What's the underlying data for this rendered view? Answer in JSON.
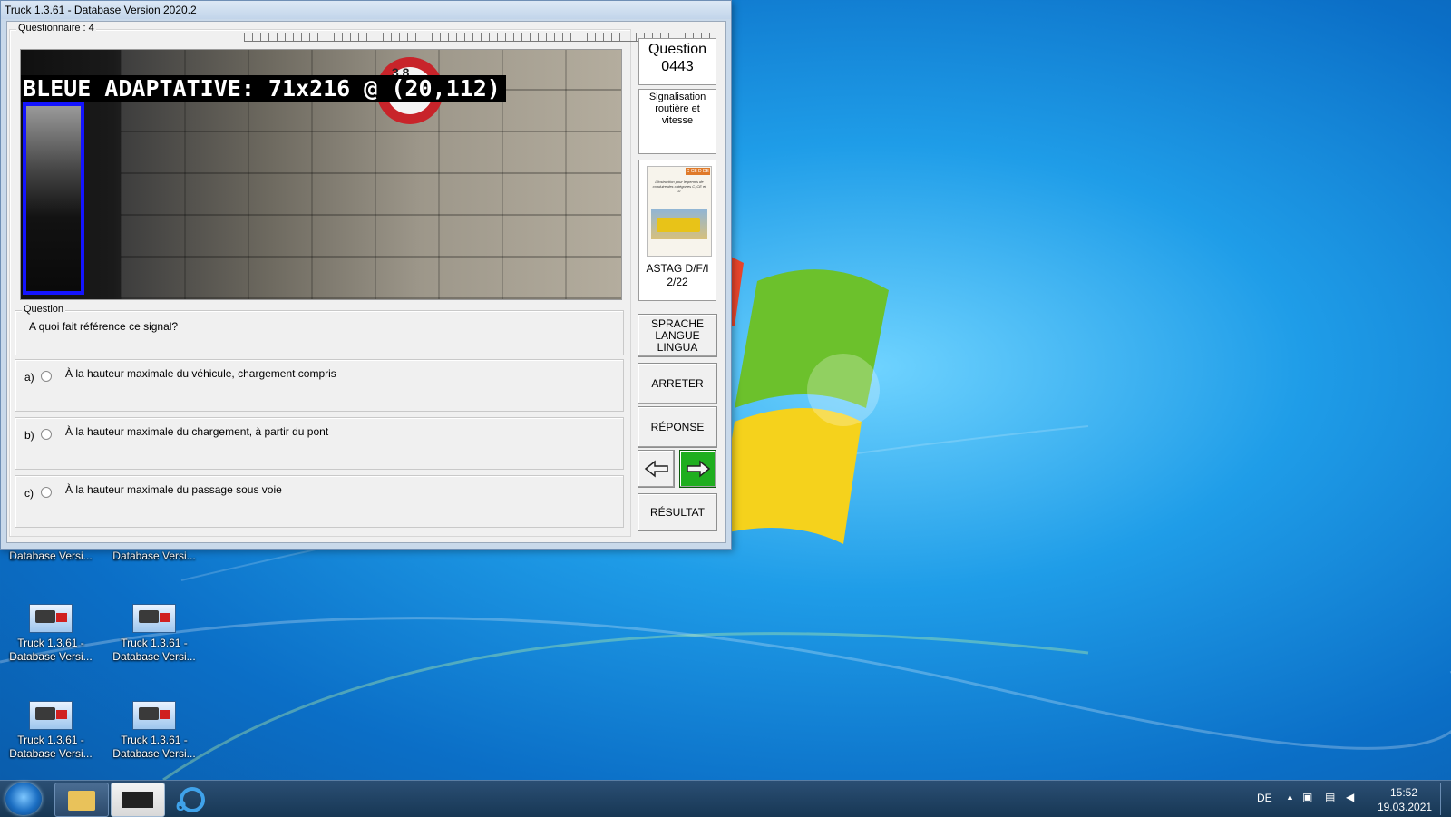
{
  "window": {
    "title": "Truck 1.3.61 - Database Version 2020.2",
    "questionnaire_label": "Questionnaire : 4"
  },
  "detection_overlay": {
    "text": "BLEUE ADAPTATIVE: 71x216 @ (20,112)",
    "box_color": "#1414ff"
  },
  "sign": {
    "text": "3,8"
  },
  "question_number": {
    "line1": "Question",
    "line2": "0443"
  },
  "category": "Signalisation routière et vitesse",
  "book": {
    "cover_title": "L'instruction pour le permis de conduire des catégories C, CE et D",
    "cover_tag": "C CE D DE",
    "label_line1": "ASTAG D/F/I",
    "label_line2": "2/22"
  },
  "question": {
    "label": "Question",
    "text": "A quoi fait référence ce signal?"
  },
  "answers": [
    {
      "letter": "a)",
      "text": "À la hauteur maximale du véhicule, chargement compris"
    },
    {
      "letter": "b)",
      "text": "À la hauteur maximale du chargement, à partir du pont"
    },
    {
      "letter": "c)",
      "text": "À la hauteur maximale du passage sous voie"
    }
  ],
  "buttons": {
    "language": [
      "SPRACHE",
      "LANGUE",
      "LINGUA"
    ],
    "stop": "ARRETER",
    "answer": "RÉPONSE",
    "result": "RÉSULTAT",
    "prev_icon": "arrow-left-icon",
    "next_icon": "arrow-right-icon",
    "next_color": "#1fae1f"
  },
  "desktop_icons": [
    {
      "line1": "",
      "line2": "Database Versi..."
    },
    {
      "line1": "",
      "line2": "Database Versi..."
    },
    {
      "line1": "Truck 1.3.61 -",
      "line2": "Database Versi..."
    },
    {
      "line1": "Truck 1.3.61 -",
      "line2": "Database Versi..."
    },
    {
      "line1": "Truck 1.3.61 -",
      "line2": "Database Versi..."
    },
    {
      "line1": "Truck 1.3.61 -",
      "line2": "Database Versi..."
    }
  ],
  "taskbar": {
    "items": [
      "start-orb-icon",
      "file-explorer-icon",
      "truck-app-icon",
      "internet-explorer-icon"
    ],
    "language": "DE",
    "time": "15:52",
    "date": "19.03.2021"
  }
}
